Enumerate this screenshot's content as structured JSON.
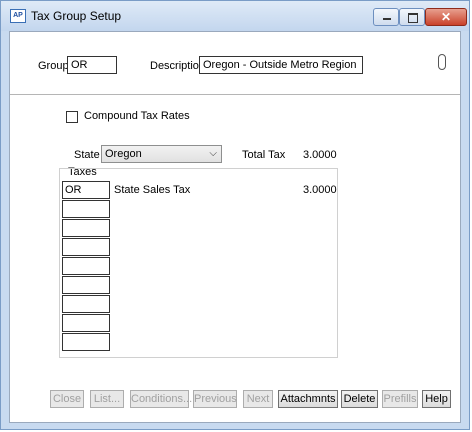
{
  "window": {
    "title": "Tax Group Setup",
    "app_icon": "AP",
    "close_glyph": "✕"
  },
  "header": {
    "group_label": "Group",
    "group_value": "OR",
    "description_label": "Description",
    "description_value": "Oregon - Outside Metro Region"
  },
  "options": {
    "compound_label": "Compound Tax Rates",
    "compound_checked": false
  },
  "state": {
    "label": "State",
    "value": "Oregon",
    "total_tax_label": "Total Tax",
    "total_tax_value": "3.0000"
  },
  "taxes": {
    "label": "Taxes",
    "rows": [
      {
        "code": "OR",
        "description": "State Sales Tax",
        "rate": "3.0000"
      },
      {
        "code": "",
        "description": "",
        "rate": ""
      },
      {
        "code": "",
        "description": "",
        "rate": ""
      },
      {
        "code": "",
        "description": "",
        "rate": ""
      },
      {
        "code": "",
        "description": "",
        "rate": ""
      },
      {
        "code": "",
        "description": "",
        "rate": ""
      },
      {
        "code": "",
        "description": "",
        "rate": ""
      },
      {
        "code": "",
        "description": "",
        "rate": ""
      },
      {
        "code": "",
        "description": "",
        "rate": ""
      }
    ]
  },
  "buttons": {
    "close": "Close",
    "list": "List...",
    "conditions": "Conditions...",
    "previous": "Previous",
    "next": "Next",
    "attachments": "Attachmnts",
    "delete": "Delete",
    "prefills": "Prefills",
    "help": "Help"
  }
}
